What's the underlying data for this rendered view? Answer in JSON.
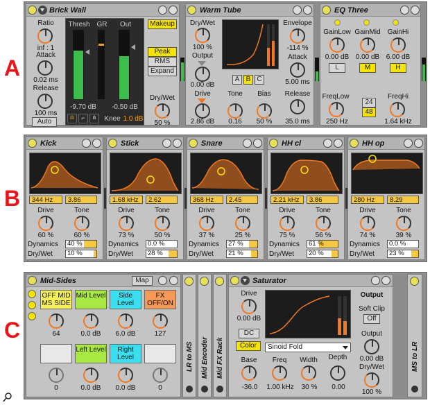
{
  "row_labels": [
    "A",
    "B",
    "C"
  ],
  "brick_wall": {
    "title": "Brick Wall",
    "ratio_label": "Ratio",
    "ratio_value": "inf : 1",
    "attack_label": "Attack",
    "attack_value": "0.02 ms",
    "release_label": "Release",
    "release_value": "100 ms",
    "auto_label": "Auto",
    "thresh_label": "Thresh",
    "gr_label": "GR",
    "out_label": "Out",
    "thresh_value": "-9.70 dB",
    "out_value": "-0.50 dB",
    "knee_label": "Knee",
    "knee_value": "1.0 dB",
    "makeup_label": "Makeup",
    "peak_label": "Peak",
    "rms_label": "RMS",
    "expand_label": "Expand",
    "drywet_label": "Dry/Wet",
    "drywet_value": "50 %"
  },
  "warm_tube": {
    "title": "Warm Tube",
    "drywet_label": "Dry/Wet",
    "drywet_value": "100 %",
    "output_label": "Output",
    "output_value": "0.00 dB",
    "drive_label": "Drive",
    "drive_value": "2.86 dB",
    "tone_label": "Tone",
    "tone_value": "0.16",
    "bias_label": "Bias",
    "bias_value": "50 %",
    "envelope_label": "Envelope",
    "envelope_value": "-114 %",
    "attack_label": "Attack",
    "attack_value": "5.00 ms",
    "release_label": "Release",
    "release_value": "35.0 ms",
    "abc": [
      "A",
      "B",
      "C"
    ]
  },
  "eq_three": {
    "title": "EQ Three",
    "gainlow_label": "GainLow",
    "gainlow_value": "0.00 dB",
    "gainmid_label": "GainMid",
    "gainmid_value": "0.00 dB",
    "gainhi_label": "GainHi",
    "gainhi_value": "6.00 dB",
    "l": "L",
    "m": "M",
    "h": "H",
    "freqlow_label": "FreqLow",
    "freqlow_value": "250 Hz",
    "freqhi_label": "FreqHi",
    "freqhi_value": "1.64 kHz",
    "slope_24": "24",
    "slope_48": "48"
  },
  "filters": [
    {
      "title": "Kick",
      "freq": "344 Hz",
      "q": "3.86",
      "drive": "60 %",
      "tone": "60 %",
      "dynamics": "40 %",
      "drywet": "10 %",
      "dyn_frac": 0.4,
      "dw_frac": 0.1
    },
    {
      "title": "Stick",
      "freq": "1.68 kHz",
      "q": "2.62",
      "drive": "73 %",
      "tone": "50 %",
      "dynamics": "0.0 %",
      "drywet": "28 %",
      "dyn_frac": 0.0,
      "dw_frac": 0.28
    },
    {
      "title": "Snare",
      "freq": "368 Hz",
      "q": "2.45",
      "drive": "37 %",
      "tone": "25 %",
      "dynamics": "27 %",
      "drywet": "21 %",
      "dyn_frac": 0.27,
      "dw_frac": 0.21
    },
    {
      "title": "HH cl",
      "freq": "2.21 kHz",
      "q": "3.86",
      "drive": "75 %",
      "tone": "56 %",
      "dynamics": "61 %",
      "drywet": "20 %",
      "dyn_frac": 0.61,
      "dw_frac": 0.2
    },
    {
      "title": "HH op",
      "freq": "280 Hz",
      "q": "8.29",
      "drive": "74 %",
      "tone": "39 %",
      "dynamics": "0.0 %",
      "drywet": "23 %",
      "dyn_frac": 0.0,
      "dw_frac": 0.23
    }
  ],
  "filter_labels": {
    "drive": "Drive",
    "tone": "Tone",
    "dynamics": "Dynamics",
    "drywet": "Dry/Wet"
  },
  "mid_sides": {
    "title": "Mid-Sides",
    "map_label": "Map",
    "macro1_label": "OFF MID MS SIDE",
    "macro1_value": "64",
    "macro2_label": "Mid Level",
    "macro2_value": "0.0 dB",
    "macro3_label": "Side Level",
    "macro3_value": "6.0 dB",
    "macro4_label": "FX OFF/ON",
    "macro4_value": "127",
    "macro5_value": "0",
    "macro6_label": "Left Level",
    "macro6_value": "0.0 dB",
    "macro7_label": "Right Level",
    "macro7_value": "0.0 dB",
    "macro8_value": "0"
  },
  "lr_to_ms": "LR to MS",
  "mid_encoder": "Mid Encoder",
  "mid_fx_rack": "Mid FX Rack",
  "ms_to_lr": "MS to LR",
  "saturator": {
    "title": "Saturator",
    "drive_label": "Drive",
    "drive_value": "0.00 dB",
    "dc_label": "DC",
    "color_label": "Color",
    "curve_select": "Sinoid Fold",
    "base_label": "Base",
    "base_value": "-36.0",
    "freq_label": "Freq",
    "freq_value": "1.00 kHz",
    "width_label": "Width",
    "width_value": "30 %",
    "depth_label": "Depth",
    "depth_value": "0.00",
    "output_section": "Output",
    "softclip_label": "Soft Clip",
    "softclip_value": "Off",
    "output_label": "Output",
    "output_value": "0.00 dB",
    "drywet_label": "Dry/Wet",
    "drywet_value": "100 %"
  },
  "zoom_icon": "magnifier-icon"
}
